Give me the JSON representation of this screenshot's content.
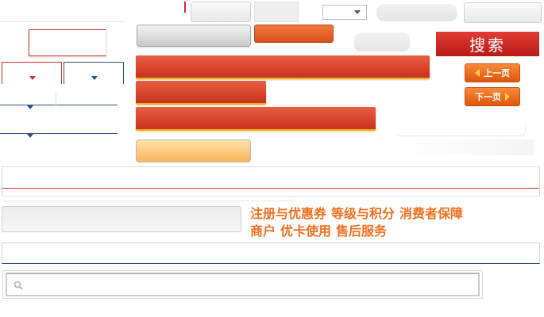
{
  "search_button_label": "搜索",
  "pager": {
    "prev_label": "上一页",
    "next_label": "下一页"
  },
  "help_links": {
    "row1": [
      "注册与优惠券",
      "等级与积分",
      "消费者保障"
    ],
    "row2": [
      "商户",
      "优卡使用",
      "售后服务"
    ]
  },
  "search_input": {
    "value": "",
    "placeholder": ""
  },
  "icons": {
    "search": "search-icon",
    "arrow_left": "arrow-left-icon",
    "arrow_right": "arrow-right-icon",
    "dropdown": "chevron-down-icon"
  },
  "colors": {
    "accent_red": "#c8321f",
    "accent_orange": "#e0560d",
    "link_orange": "#f07020",
    "rule_blue": "#2f4f7a"
  }
}
